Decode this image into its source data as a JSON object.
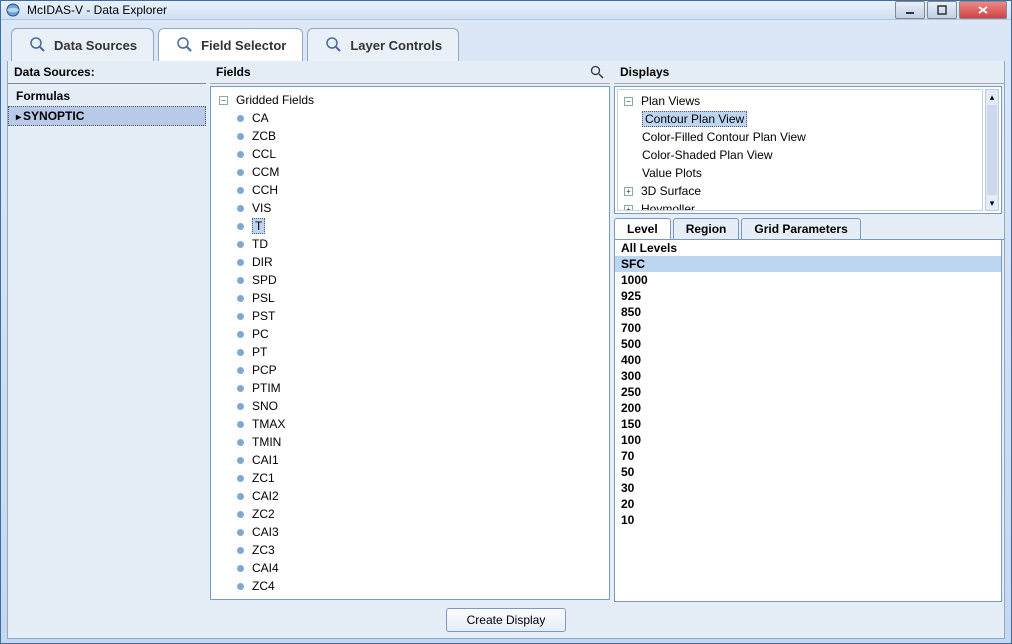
{
  "window": {
    "title": "McIDAS-V - Data Explorer"
  },
  "tabs": {
    "data_sources": "Data Sources",
    "field_selector": "Field Selector",
    "layer_controls": "Layer Controls"
  },
  "left": {
    "header": "Data Sources:",
    "items": [
      "Formulas",
      "SYNOPTIC"
    ],
    "selected": 1
  },
  "fields": {
    "header": "Fields",
    "root_label": "Gridded Fields",
    "selected": "T",
    "items": [
      "CA",
      "ZCB",
      "CCL",
      "CCM",
      "CCH",
      "VIS",
      "T",
      "TD",
      "DIR",
      "SPD",
      "PSL",
      "PST",
      "PC",
      "PT",
      "PCP",
      "PTIM",
      "SNO",
      "TMAX",
      "TMIN",
      "CAI1",
      "ZC1",
      "CAI2",
      "ZC2",
      "CAI3",
      "ZC3",
      "CAI4",
      "ZC4"
    ]
  },
  "displays": {
    "header": "Displays",
    "tree": [
      {
        "label": "Plan Views",
        "expanded": true,
        "children": [
          "Contour Plan View",
          "Color-Filled Contour Plan View",
          "Color-Shaded Plan View",
          "Value Plots"
        ],
        "selected": "Contour Plan View"
      },
      {
        "label": "3D Surface",
        "expanded": false
      },
      {
        "label": "Hovmoller",
        "expanded": false
      }
    ]
  },
  "subtabs": {
    "items": [
      "Level",
      "Region",
      "Grid Parameters"
    ],
    "active": 0
  },
  "levels": {
    "selected": "SFC",
    "items": [
      "All Levels",
      "SFC",
      "1000",
      "925",
      "850",
      "700",
      "500",
      "400",
      "300",
      "250",
      "200",
      "150",
      "100",
      "70",
      "50",
      "30",
      "20",
      "10"
    ]
  },
  "footer": {
    "create": "Create Display"
  }
}
